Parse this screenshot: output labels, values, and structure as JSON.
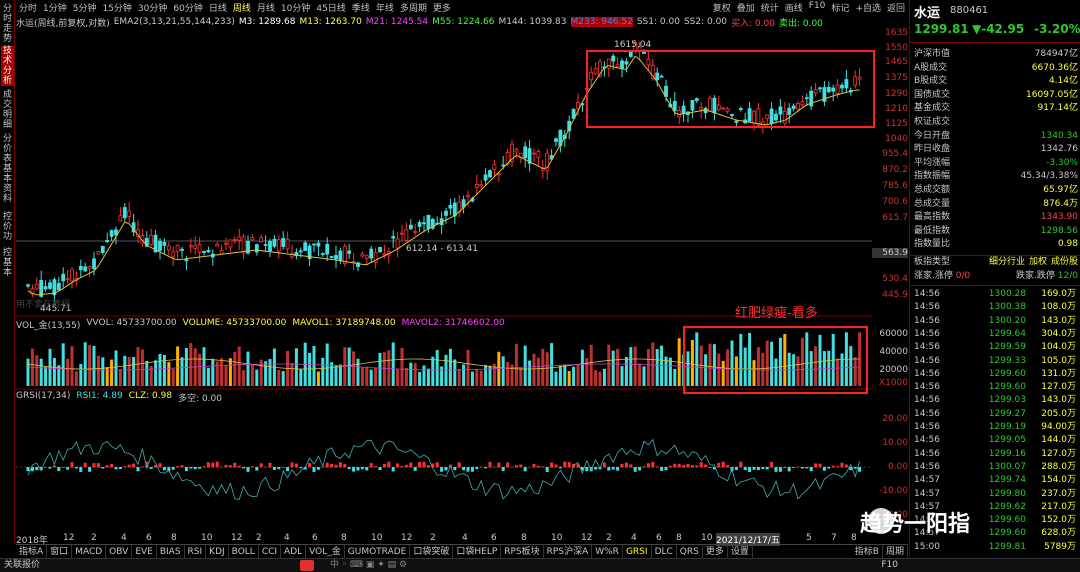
{
  "left_tabs": [
    "分时走势",
    "技术分析",
    "成交明细",
    "分价表",
    "基本资料",
    "控价功",
    "控基本"
  ],
  "left_tab_active": 1,
  "period_tabs": [
    "分时",
    "1分钟",
    "5分钟",
    "15分钟",
    "30分钟",
    "60分钟",
    "日线",
    "周线",
    "月线",
    "10分钟",
    "45日线",
    "季线",
    "年线",
    "多周期",
    "更多"
  ],
  "period_active": 7,
  "toolbar": [
    "复权",
    "叠加",
    "统计",
    "画线",
    "F10",
    "标记",
    "+自选",
    "返回"
  ],
  "info_line": {
    "name": "水运(周线,前复权,对数)",
    "ema": "EMA2(3,13,21,55,144,233)",
    "m3": "M3: 1289.68",
    "m13": "M13: 1263.70",
    "m21": "M21: 1245.54",
    "m55": "M55: 1224.66",
    "m144": "M144: 1039.83",
    "m233": "M233: 946.52",
    "ss1": "SS1: 0.00",
    "ss2": "SS2: 0.00",
    "buy": "买入: 0.00",
    "sell": "卖出: 0.00"
  },
  "price_axis": [
    "1635",
    "1550",
    "1465",
    "1375",
    "1290",
    "1210",
    "1125",
    "1040",
    "955.4",
    "870.2",
    "785.6",
    "700.6",
    "615.7",
    "530.4",
    "445.9"
  ],
  "price_marker": "563.9",
  "annot_high": "1615.04",
  "annot_range": "612.14 - 613.41",
  "annot_low": "445.71",
  "annot_faint": "用不卖在教程",
  "vol_line": {
    "name": "VOL_金(13,55)",
    "vvol": "VVOL: 45733700.00",
    "volume": "VOLUME: 45733700.00",
    "mavol1": "MAVOL1: 37189748.00",
    "mavol2": "MAVOL2: 31746602.00"
  },
  "vol_axis": [
    "60000",
    "40000",
    "20000",
    "X1000"
  ],
  "grsi_line": {
    "name": "GRSI(17,34)",
    "rsi1": "RSI1: 4.89",
    "clz": "CLZ: 0.98",
    "kz": "多空: 0.00"
  },
  "grsi_axis": [
    "20.00",
    "10.00",
    "0.00",
    "-10.00",
    "-20.00"
  ],
  "annotation_text": "红肥绿瘦-看多",
  "x_axis": [
    "2018年",
    "12",
    "2",
    "4",
    "6",
    "8",
    "10",
    "12",
    "2",
    "4",
    "6",
    "8",
    "10",
    "12",
    "2",
    "4",
    "6",
    "8",
    "10",
    "12",
    "2",
    "4",
    "6",
    "8",
    "10",
    "1",
    "2021/12/17/五",
    "5",
    "7",
    "8"
  ],
  "bottom_tabs": [
    "指标A",
    "窗口",
    "MACD",
    "OBV",
    "EVE",
    "BIAS",
    "RSI",
    "KDJ",
    "BOLL",
    "CCI",
    "ADL",
    "VOL_金",
    "GUMOTRADE",
    "口袋突破",
    "口袋HELP",
    "RPS板块",
    "RPS沪深A",
    "W%R",
    "GRSI",
    "DLC",
    "QRS",
    "更多",
    "设置"
  ],
  "bottom_active": 18,
  "bottom_right": "指标B",
  "bottom_right2": "周期",
  "status": {
    "left": "关联报价",
    "right": "F10"
  },
  "right_panel": {
    "title": "水运",
    "code": "880461",
    "price": "1299.81",
    "change": "▼-42.95",
    "pct": "-3.20%",
    "stats": [
      [
        "沪深市值",
        "784947亿",
        "w"
      ],
      [
        "A股成交",
        "6670.36亿",
        "y"
      ],
      [
        "B股成交",
        "4.14亿",
        "y"
      ],
      [
        "国债成交",
        "16097.05亿",
        "y"
      ],
      [
        "基金成交",
        "917.14亿",
        "y"
      ],
      [
        "权证成交",
        "",
        "w"
      ],
      [
        "今日开盘",
        "1340.34",
        "g"
      ],
      [
        "昨日收盘",
        "1342.76",
        "w"
      ],
      [
        "平均涨幅",
        "-3.30%",
        "g"
      ],
      [
        "指数振幅",
        "45.34/3.38%",
        "w"
      ],
      [
        "总成交额",
        "65.97亿",
        "y"
      ],
      [
        "总成交量",
        "876.4万",
        "y"
      ],
      [
        "最高指数",
        "1343.90",
        "r"
      ],
      [
        "最低指数",
        "1298.56",
        "g"
      ],
      [
        "指数量比",
        "0.98",
        "y"
      ]
    ],
    "plate_label": "板指类型",
    "plate_links": [
      "细分行业",
      "加权",
      "成份股"
    ],
    "updown": {
      "k1": "涨家.涨停",
      "v1": "0/0",
      "k2": "跌家.跌停",
      "v2": "12/0"
    },
    "ticks": [
      [
        "14:56",
        "1300.28",
        "169.0万"
      ],
      [
        "14:56",
        "1300.38",
        "108.0万"
      ],
      [
        "14:56",
        "1300.20",
        "143.0万"
      ],
      [
        "14:56",
        "1299.64",
        "304.0万"
      ],
      [
        "14:56",
        "1299.59",
        "104.0万"
      ],
      [
        "14:56",
        "1299.33",
        "105.0万"
      ],
      [
        "14:56",
        "1299.60",
        "131.0万"
      ],
      [
        "14:56",
        "1299.60",
        "127.0万"
      ],
      [
        "14:56",
        "1299.03",
        "143.0万"
      ],
      [
        "14:56",
        "1299.27",
        "205.0万"
      ],
      [
        "14:56",
        "1299.19",
        "94.00万"
      ],
      [
        "14:56",
        "1299.05",
        "144.0万"
      ],
      [
        "14:56",
        "1299.16",
        "127.0万"
      ],
      [
        "14:56",
        "1300.07",
        "288.0万"
      ],
      [
        "14:57",
        "1299.74",
        "154.0万"
      ],
      [
        "14:57",
        "1299.80",
        "237.0万"
      ],
      [
        "14:57",
        "1299.62",
        "217.0万"
      ],
      [
        "14:57",
        "1299.60",
        "152.0万"
      ],
      [
        "14:57",
        "1299.60",
        "628.0万"
      ],
      [
        "15:00",
        "1299.81",
        "5789万"
      ]
    ]
  },
  "watermark": "趋势一阳指",
  "colors": {
    "up": "#ff3030",
    "down": "#40e0e0",
    "ma": "#e0c040",
    "accent": "#a00000"
  }
}
